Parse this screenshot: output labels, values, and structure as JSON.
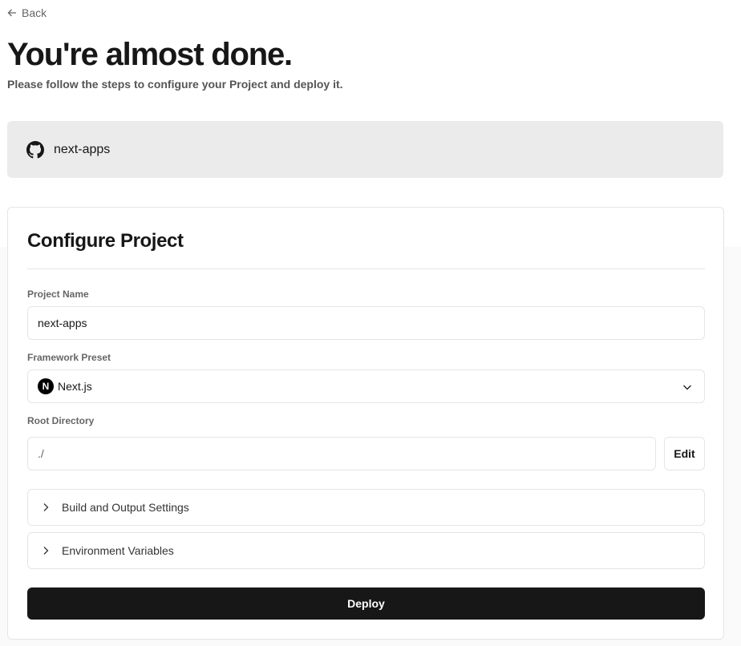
{
  "nav": {
    "back_label": "Back"
  },
  "hero": {
    "title": "You're almost done.",
    "subtitle": "Please follow the steps to configure your Project and deploy it."
  },
  "repo": {
    "name": "next-apps",
    "icon": "github-icon"
  },
  "config": {
    "title": "Configure Project",
    "project_name": {
      "label": "Project Name",
      "value": "next-apps"
    },
    "framework": {
      "label": "Framework Preset",
      "value": "Next.js",
      "logo_letter": "N"
    },
    "root_directory": {
      "label": "Root Directory",
      "value": "./",
      "edit_label": "Edit"
    },
    "build_settings_label": "Build and Output Settings",
    "env_vars_label": "Environment Variables",
    "deploy_label": "Deploy"
  },
  "colors": {
    "primary": "#171717",
    "repo_card_bg": "#ebebeb",
    "border": "#e5e5e5"
  }
}
